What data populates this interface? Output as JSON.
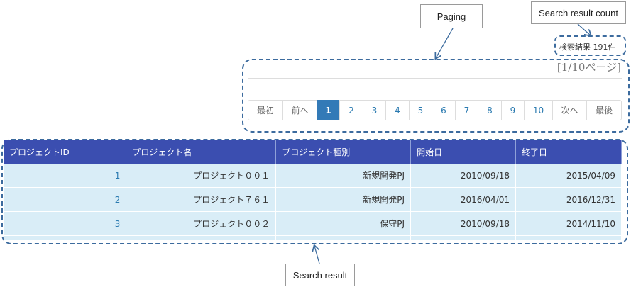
{
  "annotations": {
    "paging": "Paging",
    "search_result_count": "Search result count",
    "search_result": "Search result"
  },
  "result_count": "検索結果 191件",
  "page_info": "[1/10ページ]",
  "pagination": {
    "items": [
      "最初",
      "前へ",
      "1",
      "2",
      "3",
      "4",
      "5",
      "6",
      "7",
      "8",
      "9",
      "10",
      "次へ",
      "最後"
    ],
    "active": "1"
  },
  "table": {
    "headers": [
      "プロジェクトID",
      "プロジェクト名",
      "プロジェクト種別",
      "開始日",
      "終了日"
    ],
    "rows": [
      [
        "1",
        "プロジェクト００１",
        "新規開発PJ",
        "2010/09/18",
        "2015/04/09"
      ],
      [
        "2",
        "プロジェクト７６１",
        "新規開発PJ",
        "2016/04/01",
        "2016/12/31"
      ],
      [
        "3",
        "プロジェクト００２",
        "保守PJ",
        "2010/09/18",
        "2014/11/10"
      ]
    ]
  },
  "colors": {
    "header_bg": "#3b4eb0",
    "row_bg": "#d9edf7",
    "active_page": "#337ab7",
    "dashed_border": "#3c6b9e"
  }
}
